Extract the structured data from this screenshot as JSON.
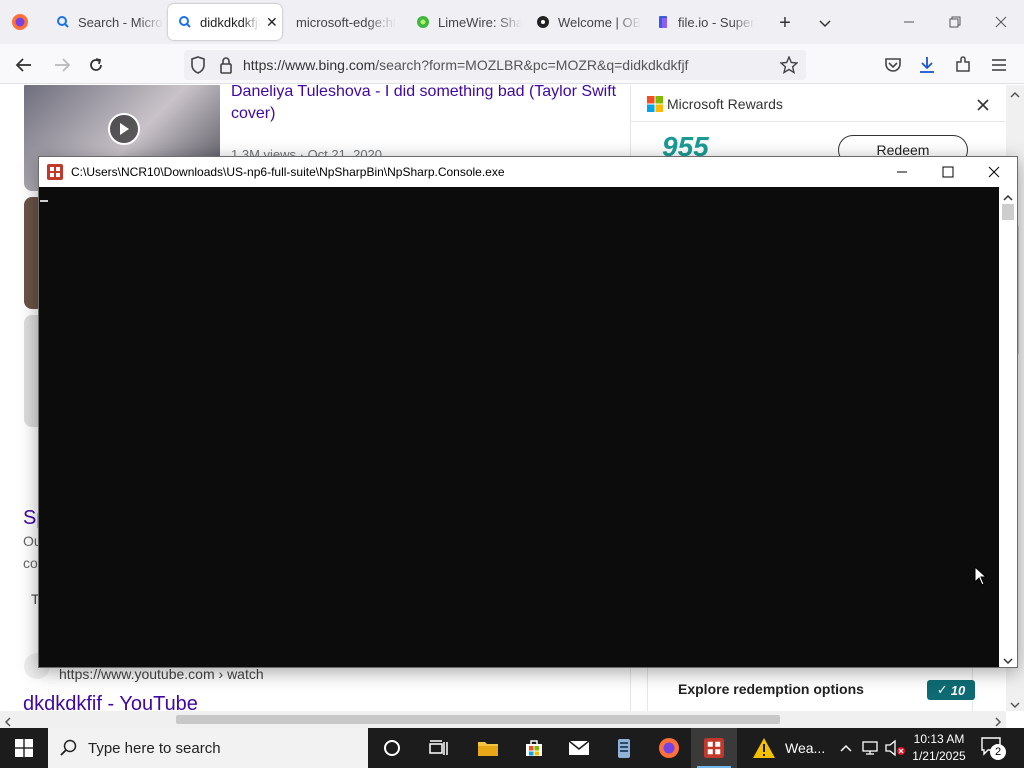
{
  "browser": {
    "tabs": [
      {
        "label": "Search - Micros",
        "active": false
      },
      {
        "label": "didkdkdkfjf",
        "active": true
      },
      {
        "label": "microsoft-edge:ht",
        "active": false
      },
      {
        "label": "LimeWire: Sha",
        "active": false
      },
      {
        "label": "Welcome | OB",
        "active": false
      },
      {
        "label": "file.io - Super",
        "active": false
      }
    ],
    "url_host": "https://www.bing.com",
    "url_path": "/search?form=MOZLBR&pc=MOZR&q=didkdkdkfjf"
  },
  "page": {
    "video_title_line1": "Daneliya Tuleshova - I did something bad (Taylor Swift",
    "video_title_line2": "cover)",
    "video_meta": "1.3M views · Oct 21, 2020",
    "partial_left_1": "Sp",
    "partial_left_2": "Ou",
    "partial_left_3": "co",
    "partial_left_4": "T",
    "result_url": "https://www.youtube.com › watch",
    "result_title": "dkdkdkfif - YouTube"
  },
  "rewards": {
    "title": "Microsoft Rewards",
    "points": "955",
    "redeem_label": "Redeem",
    "explore_label": "Explore redemption options",
    "badge_value": "10"
  },
  "console": {
    "title": "C:\\Users\\NCR10\\Downloads\\US-np6-full-suite\\NpSharpBin\\NpSharp.Console.exe"
  },
  "taskbar": {
    "search_placeholder": "Type here to search",
    "weather_label": "Wea...",
    "time": "10:13 AM",
    "date": "1/21/2025",
    "notification_count": "2"
  },
  "colors": {
    "link": "#4007a2",
    "rewards_points": "#1a9c95",
    "badge_bg": "#0f6b73",
    "taskbar_bg": "#1c1c1c"
  }
}
